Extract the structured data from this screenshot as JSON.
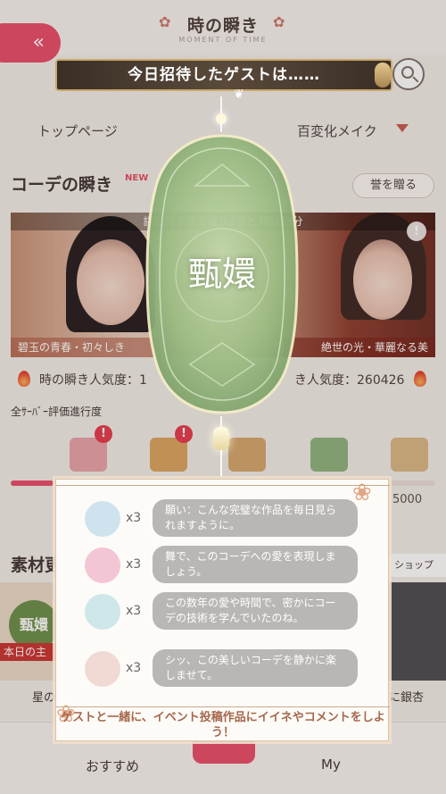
{
  "header": {
    "title": "時の瞬き",
    "subtitle": "MOMENT OF TIME"
  },
  "tabs": [
    "トップページ",
    "百変化メイク"
  ],
  "sections": {
    "coord_title": "コーデの瞬き",
    "new_badge": "NEW",
    "gift_button": "誉を贈る",
    "materials_title": "素材更"
  },
  "banner": {
    "time_text": "評価終了まで残り2日と3時間3分",
    "caption_left": "碧玉の青春・初々しき",
    "caption_right": "絶世の光・華麗なる美"
  },
  "popularity": {
    "left": "時の瞬き人気度：1",
    "right": "き人気度：260426"
  },
  "progress": {
    "label": "全ｻｰﾊﾞｰ評価進行度",
    "value_text": "5000",
    "fraction": 0.1
  },
  "materials": {
    "seal_text": "甄嬛",
    "ribbon_text": "本日の主",
    "caption_left": "星の",
    "caption_right": "に銀杏",
    "shop_tag": "ショップ"
  },
  "bottom_nav": {
    "left": "おすすめ",
    "right": "My"
  },
  "overlay": {
    "banner_text": "今日招待したゲストは……",
    "guest_name": "甄嬛",
    "messages": [
      {
        "count": "x3",
        "text": "願い：こんな完璧な作品を毎日見られますように。",
        "avatar_color": "#cfe3ef"
      },
      {
        "count": "x3",
        "text": "舞で、このコーデへの愛を表現しましょう。",
        "avatar_color": "#f3c6d6"
      },
      {
        "count": "x3",
        "text": "この数年の愛や時間で、密かにコーデの技術を学んでいたのね。",
        "avatar_color": "#cfe7e9"
      },
      {
        "count": "x3",
        "text": "シッ、この美しいコーデを静かに楽しませて。",
        "avatar_color": "#f1d9d4"
      }
    ],
    "footer": "ゲストと一緒に、イベント投稿作品にイイネやコメントをしよう！"
  },
  "colors": {
    "accent": "#e74a68",
    "jade": "#a7c48f",
    "gold": "#c9a86b"
  }
}
